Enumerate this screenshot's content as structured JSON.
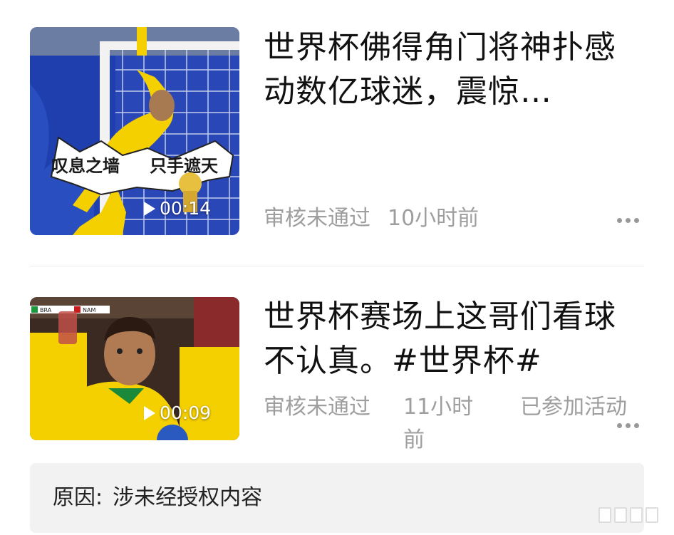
{
  "posts": [
    {
      "title": "世界杯佛得角门将神扑感动数亿球迷，震惊…",
      "duration": "00:14",
      "thumbnail_caption_left": "叹息之墙",
      "thumbnail_caption_right": "只手遮天",
      "status": "审核未通过",
      "time": "10小时前"
    },
    {
      "title": "世界杯赛场上这哥们看球不认真。#世界杯#",
      "duration": "00:09",
      "status": "审核未通过",
      "time": "11小时前",
      "activity": "已参加活动",
      "scoreboard_left": "BRA",
      "scoreboard_right": "NAM"
    }
  ],
  "reason": {
    "label": "原因:",
    "text": "涉未经授权内容"
  },
  "colors": {
    "meta_gray": "#9e9e9e",
    "reason_bg": "#f2f2f2",
    "jersey_yellow": "#f5d000",
    "stadium_blue": "#1f3fae"
  },
  "icons": [
    "play-icon",
    "more-icon"
  ]
}
